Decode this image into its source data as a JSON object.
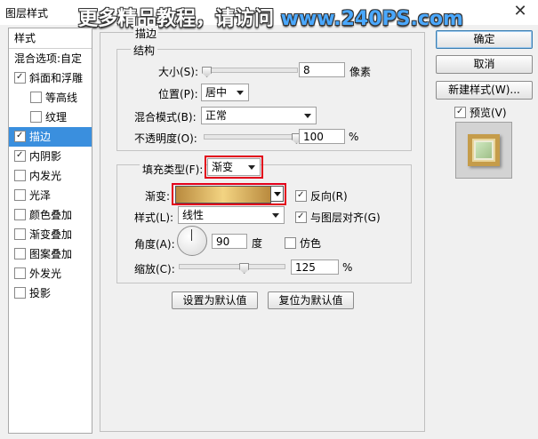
{
  "window": {
    "title": "图层样式",
    "close": "✕"
  },
  "watermark": {
    "text": "更多精品教程，请访问 ",
    "site": "www.240PS.com"
  },
  "sidebar": {
    "header": "样式",
    "items": [
      {
        "label": "混合选项:自定",
        "checkbox": false,
        "checked": false
      },
      {
        "label": "斜面和浮雕",
        "checkbox": true,
        "checked": true
      },
      {
        "label": "等高线",
        "checkbox": true,
        "checked": false
      },
      {
        "label": "纹理",
        "checkbox": true,
        "checked": false
      },
      {
        "label": "描边",
        "checkbox": true,
        "checked": true,
        "selected": true
      },
      {
        "label": "内阴影",
        "checkbox": true,
        "checked": true
      },
      {
        "label": "内发光",
        "checkbox": true,
        "checked": false
      },
      {
        "label": "光泽",
        "checkbox": true,
        "checked": false
      },
      {
        "label": "颜色叠加",
        "checkbox": true,
        "checked": false
      },
      {
        "label": "渐变叠加",
        "checkbox": true,
        "checked": false
      },
      {
        "label": "图案叠加",
        "checkbox": true,
        "checked": false
      },
      {
        "label": "外发光",
        "checkbox": true,
        "checked": false
      },
      {
        "label": "投影",
        "checkbox": true,
        "checked": false
      }
    ]
  },
  "panel": {
    "title": "描边",
    "structure": {
      "title": "结构",
      "size_label": "大小(S):",
      "size_value": "8",
      "size_unit": "像素",
      "size_fraction": 0.03,
      "position_label": "位置(P):",
      "position_value": "居中",
      "blend_label": "混合模式(B):",
      "blend_value": "正常",
      "opacity_label": "不透明度(O):",
      "opacity_value": "100",
      "opacity_unit": "%",
      "opacity_fraction": 1.0
    },
    "fill": {
      "type_label": "填充类型(F):",
      "type_value": "渐变",
      "gradient_label": "渐变:",
      "reverse_label": "反向(R)",
      "reverse_checked": true,
      "style_label": "样式(L):",
      "style_value": "线性",
      "align_label": "与图层对齐(G)",
      "align_checked": true,
      "angle_label": "角度(A):",
      "angle_value": "90",
      "angle_unit": "度",
      "dither_label": "仿色",
      "dither_checked": false,
      "scale_label": "缩放(C):",
      "scale_value": "125",
      "scale_unit": "%",
      "scale_fraction": 0.62
    },
    "make_default": "设置为默认值",
    "reset_default": "复位为默认值"
  },
  "buttons": {
    "ok": "确定",
    "cancel": "取消",
    "new_style": "新建样式(W)...",
    "preview_label": "预览(V)",
    "preview_checked": true
  },
  "colors": {
    "selection": "#3a8fde",
    "highlight": "#e2001a",
    "gradient": [
      "#b98a3e",
      "#f3d482",
      "#b98a3e"
    ]
  }
}
